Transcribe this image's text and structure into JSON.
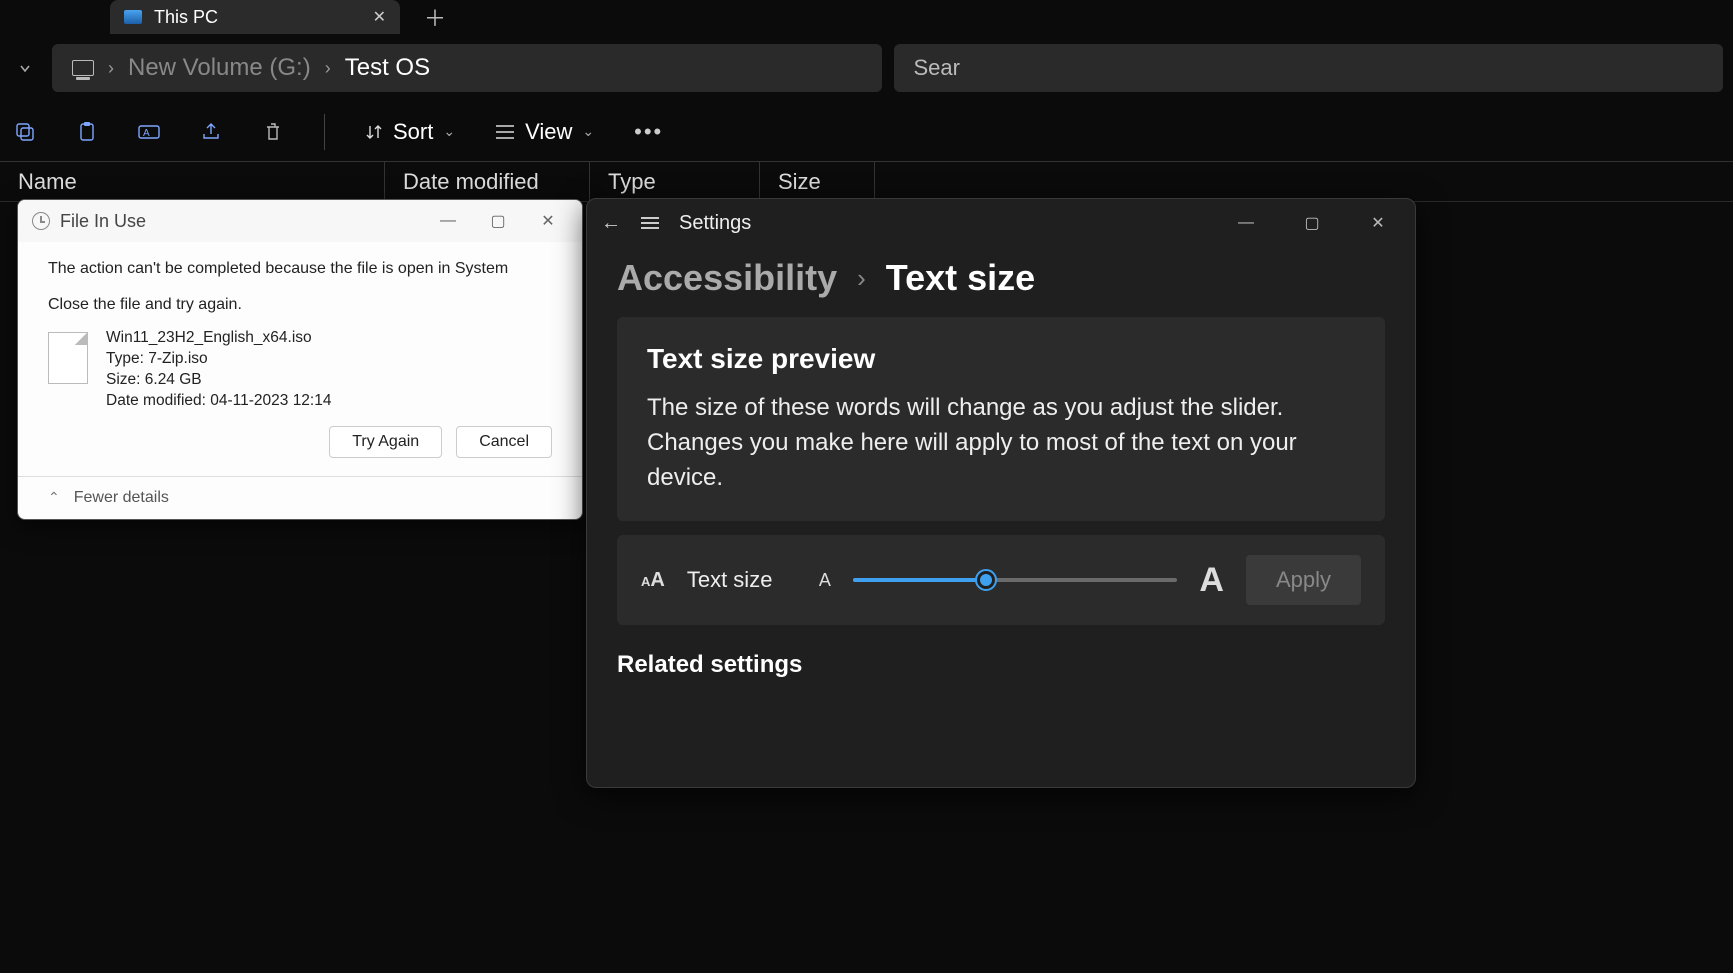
{
  "explorer": {
    "tab": {
      "title": "This PC"
    },
    "breadcrumb": {
      "seg1": "New Volume (G:)",
      "seg2": "Test OS"
    },
    "search_placeholder": "Sear",
    "toolbar": {
      "sort": "Sort",
      "view": "View"
    },
    "columns": {
      "name": "Name",
      "date": "Date modified",
      "type": "Type",
      "size": "Size"
    }
  },
  "dialog": {
    "title": "File In Use",
    "msg1": "The action can't be completed because the file is open in System",
    "msg2": "Close the file and try again.",
    "file": {
      "name": "Win11_23H2_English_x64.iso",
      "type_line": "Type: 7-Zip.iso",
      "size_line": "Size: 6.24 GB",
      "date_line": "Date modified: 04-11-2023 12:14"
    },
    "btn_try": "Try Again",
    "btn_cancel": "Cancel",
    "fewer": "Fewer details"
  },
  "settings": {
    "app_name": "Settings",
    "crumb_parent": "Accessibility",
    "crumb_current": "Text size",
    "preview_title": "Text size preview",
    "preview_text": "The size of these words will change as you adjust the slider. Changes you make here will apply to most of the text on your device.",
    "slider_label": "Text size",
    "apply": "Apply",
    "related": "Related settings"
  }
}
